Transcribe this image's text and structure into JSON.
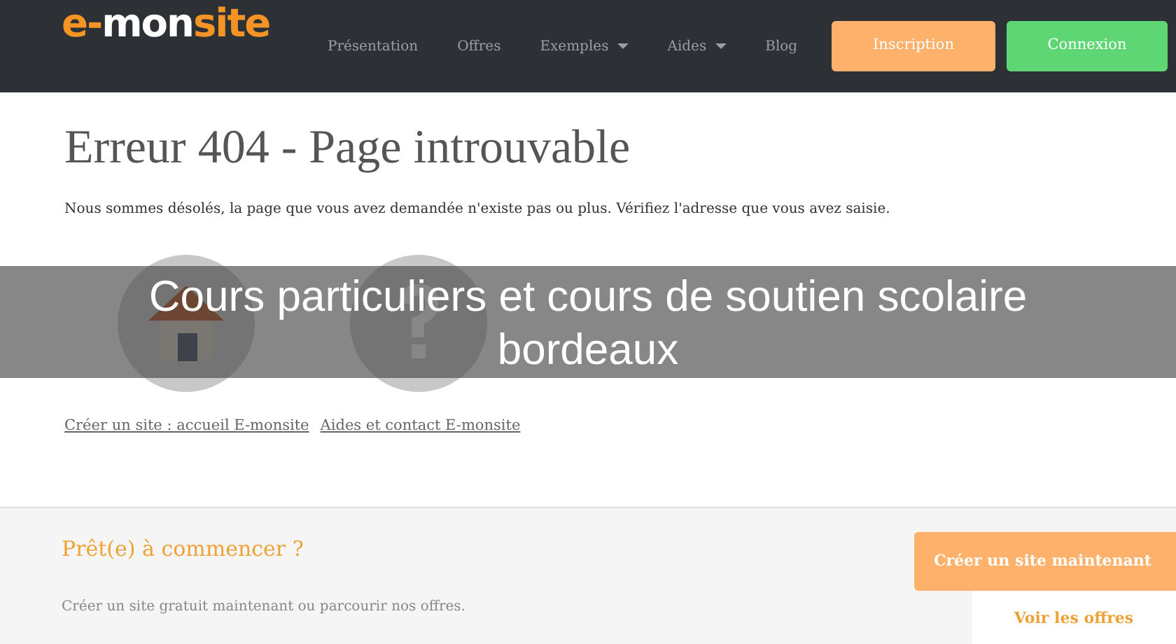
{
  "navbar": {
    "logo": [
      {
        "text": "e-",
        "color": "#f39425"
      },
      {
        "text": "mon",
        "color": "#ffffff"
      },
      {
        "text": "site",
        "color": "#f39425"
      }
    ],
    "menu": [
      {
        "label": "Présentation",
        "dropdown": false
      },
      {
        "label": "Offres",
        "dropdown": false
      },
      {
        "label": "Exemples",
        "dropdown": true
      },
      {
        "label": "Aides",
        "dropdown": true
      },
      {
        "label": "Blog",
        "dropdown": false
      }
    ],
    "buttons": [
      {
        "label": "Inscription",
        "kind": "signup"
      },
      {
        "label": "Connexion",
        "kind": "login"
      }
    ]
  },
  "error": {
    "title": "Erreur 404 - Page introuvable",
    "message": "Nous sommes désolés, la page que vous avez demandée n'existe pas ou plus. Vérifiez l'adresse que vous avez saisie.",
    "icons": [
      {
        "kind": "home"
      },
      {
        "kind": "help"
      }
    ],
    "links": [
      "Créer un site : accueil E-monsite",
      "Aides et contact E-monsite"
    ]
  },
  "overlay_caption": "Cours particuliers et cours de soutien scolaire bordeaux",
  "footer": {
    "title": "Prêt(e) à commencer ?",
    "text": "Créer un site gratuit maintenant ou parcourir nos offres.",
    "buttons": [
      {
        "label": "Créer un site maintenant",
        "kind": "primary"
      },
      {
        "label": "Voir les offres",
        "kind": "secondary"
      }
    ]
  }
}
